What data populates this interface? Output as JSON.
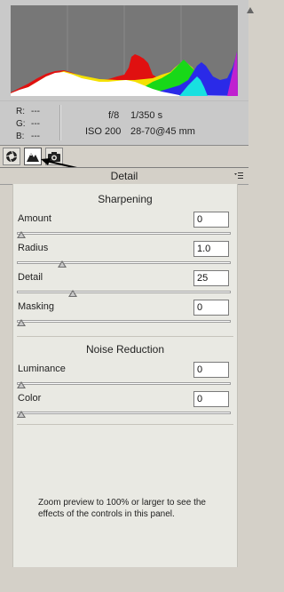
{
  "histogram": {
    "background": "#c9c9c9",
    "shadow_clip_icon": "shadow-clipping-icon",
    "highlight_clip_icon": "highlight-clipping-icon"
  },
  "readout": {
    "r_label": "R:",
    "r_value": "---",
    "g_label": "G:",
    "g_value": "---",
    "b_label": "B:",
    "b_value": "---",
    "aperture": "f/8",
    "shutter": "1/350 s",
    "iso": "ISO 200",
    "lens": "28-70@45 mm"
  },
  "tabs": [
    {
      "name": "basic",
      "icon": "aperture-icon",
      "active": false
    },
    {
      "name": "detail",
      "icon": "mountain-icon",
      "active": true
    },
    {
      "name": "lens",
      "icon": "camera-icon",
      "active": false
    }
  ],
  "section": {
    "title": "Detail",
    "menu_icon": "panel-menu-icon"
  },
  "sharpening": {
    "title": "Sharpening",
    "controls": [
      {
        "label": "Amount",
        "value": "0",
        "fraction": 0.0
      },
      {
        "label": "Radius",
        "value": "1.0",
        "fraction": 0.2
      },
      {
        "label": "Detail",
        "value": "25",
        "fraction": 0.25
      },
      {
        "label": "Masking",
        "value": "0",
        "fraction": 0.0
      }
    ]
  },
  "noise_reduction": {
    "title": "Noise Reduction",
    "controls": [
      {
        "label": "Luminance",
        "value": "0",
        "fraction": 0.0
      },
      {
        "label": "Color",
        "value": "0",
        "fraction": 0.0
      }
    ]
  },
  "hint": "Zoom preview to 100% or larger to see the effects of the controls in this panel."
}
